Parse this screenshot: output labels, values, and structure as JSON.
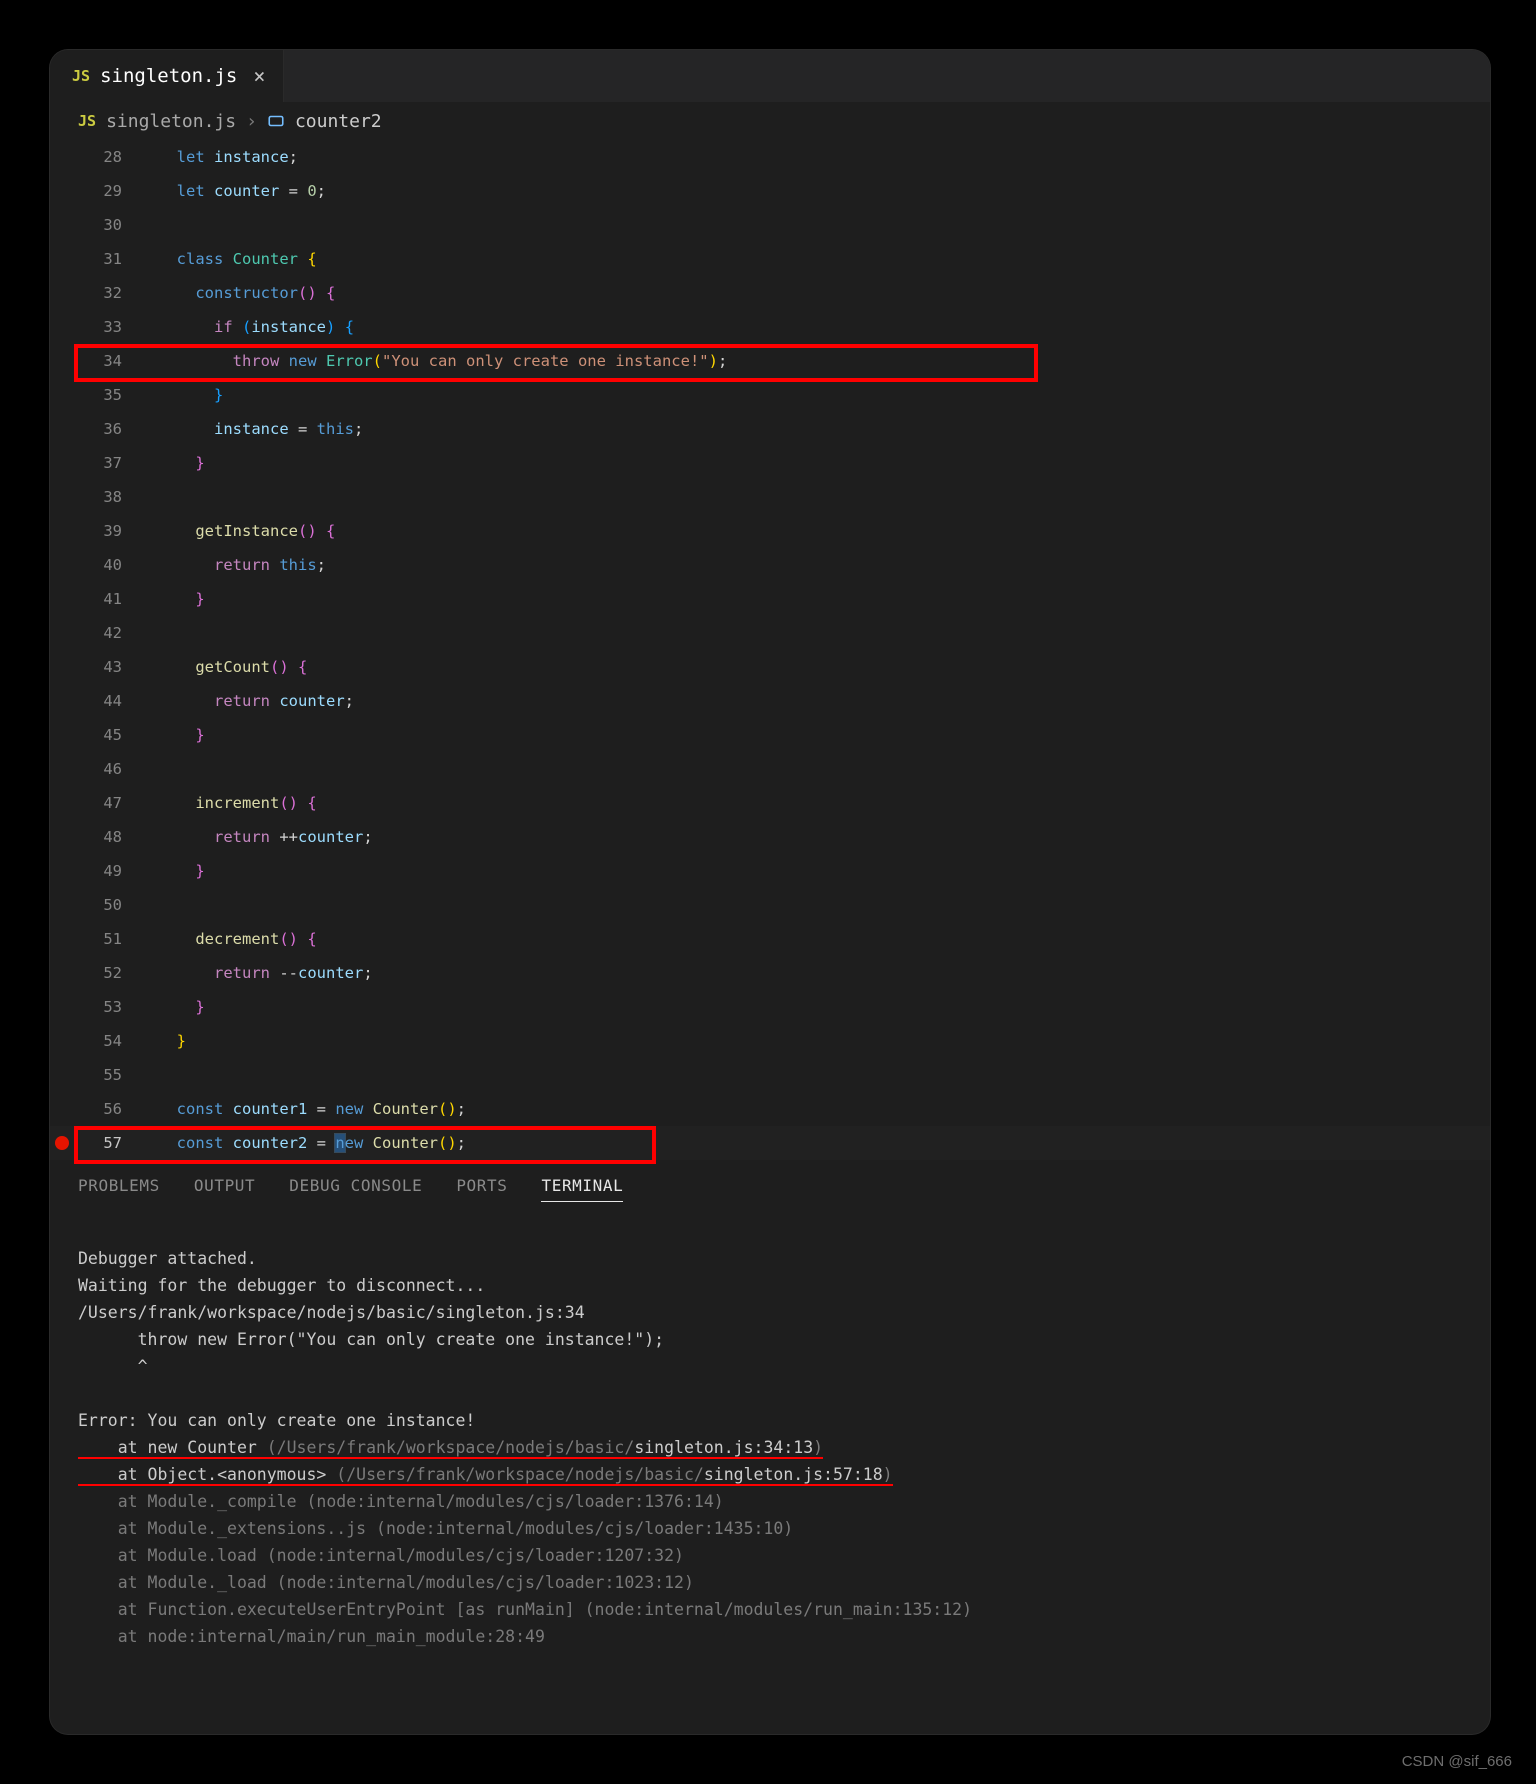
{
  "tab": {
    "icon_label": "JS",
    "filename": "singleton.js",
    "close_glyph": "×"
  },
  "breadcrumb": {
    "icon_label": "JS",
    "file": "singleton.js",
    "sep": "›",
    "symbol_icon": "⊞",
    "symbol": "counter2"
  },
  "code": {
    "lines": [
      {
        "n": "28",
        "ind": 1,
        "tokens": [
          [
            "kw-blue",
            "let "
          ],
          [
            "var",
            "instance"
          ],
          [
            "punc",
            ";"
          ]
        ]
      },
      {
        "n": "29",
        "ind": 1,
        "tokens": [
          [
            "kw-blue",
            "let "
          ],
          [
            "var",
            "counter"
          ],
          [
            "op",
            " = "
          ],
          [
            "num",
            "0"
          ],
          [
            "punc",
            ";"
          ]
        ]
      },
      {
        "n": "30",
        "ind": 0,
        "tokens": []
      },
      {
        "n": "31",
        "ind": 1,
        "tokens": [
          [
            "kw-blue",
            "class "
          ],
          [
            "cls",
            "Counter"
          ],
          [
            "punc",
            " "
          ],
          [
            "paren",
            "{"
          ]
        ]
      },
      {
        "n": "32",
        "ind": 2,
        "tokens": [
          [
            "kw-blue",
            "constructor"
          ],
          [
            "paren2",
            "()"
          ],
          [
            "punc",
            " "
          ],
          [
            "paren2",
            "{"
          ]
        ]
      },
      {
        "n": "33",
        "ind": 3,
        "tokens": [
          [
            "kw-purple",
            "if "
          ],
          [
            "brace-b",
            "("
          ],
          [
            "var",
            "instance"
          ],
          [
            "brace-b",
            ")"
          ],
          [
            "punc",
            " "
          ],
          [
            "brace-b",
            "{"
          ]
        ]
      },
      {
        "n": "34",
        "ind": 4,
        "tokens": [
          [
            "kw-purple",
            "throw "
          ],
          [
            "kw-blue",
            "new "
          ],
          [
            "cls",
            "Error"
          ],
          [
            "paren",
            "("
          ],
          [
            "str",
            "\"You can only create one instance!\""
          ],
          [
            "paren",
            ")"
          ],
          [
            "punc",
            ";"
          ]
        ]
      },
      {
        "n": "35",
        "ind": 3,
        "tokens": [
          [
            "brace-b",
            "}"
          ]
        ]
      },
      {
        "n": "36",
        "ind": 3,
        "tokens": [
          [
            "var",
            "instance"
          ],
          [
            "op",
            " = "
          ],
          [
            "kw-blue",
            "this"
          ],
          [
            "punc",
            ";"
          ]
        ]
      },
      {
        "n": "37",
        "ind": 2,
        "tokens": [
          [
            "paren2",
            "}"
          ]
        ]
      },
      {
        "n": "38",
        "ind": 0,
        "tokens": []
      },
      {
        "n": "39",
        "ind": 2,
        "tokens": [
          [
            "fn",
            "getInstance"
          ],
          [
            "paren2",
            "()"
          ],
          [
            "punc",
            " "
          ],
          [
            "paren2",
            "{"
          ]
        ]
      },
      {
        "n": "40",
        "ind": 3,
        "tokens": [
          [
            "kw-purple",
            "return "
          ],
          [
            "kw-blue",
            "this"
          ],
          [
            "punc",
            ";"
          ]
        ]
      },
      {
        "n": "41",
        "ind": 2,
        "tokens": [
          [
            "paren2",
            "}"
          ]
        ]
      },
      {
        "n": "42",
        "ind": 0,
        "tokens": []
      },
      {
        "n": "43",
        "ind": 2,
        "tokens": [
          [
            "fn",
            "getCount"
          ],
          [
            "paren2",
            "()"
          ],
          [
            "punc",
            " "
          ],
          [
            "paren2",
            "{"
          ]
        ]
      },
      {
        "n": "44",
        "ind": 3,
        "tokens": [
          [
            "kw-purple",
            "return "
          ],
          [
            "var",
            "counter"
          ],
          [
            "punc",
            ";"
          ]
        ]
      },
      {
        "n": "45",
        "ind": 2,
        "tokens": [
          [
            "paren2",
            "}"
          ]
        ]
      },
      {
        "n": "46",
        "ind": 0,
        "tokens": []
      },
      {
        "n": "47",
        "ind": 2,
        "tokens": [
          [
            "fn",
            "increment"
          ],
          [
            "paren2",
            "()"
          ],
          [
            "punc",
            " "
          ],
          [
            "paren2",
            "{"
          ]
        ]
      },
      {
        "n": "48",
        "ind": 3,
        "tokens": [
          [
            "kw-purple",
            "return "
          ],
          [
            "op",
            "++"
          ],
          [
            "var",
            "counter"
          ],
          [
            "punc",
            ";"
          ]
        ]
      },
      {
        "n": "49",
        "ind": 2,
        "tokens": [
          [
            "paren2",
            "}"
          ]
        ]
      },
      {
        "n": "50",
        "ind": 0,
        "tokens": []
      },
      {
        "n": "51",
        "ind": 2,
        "tokens": [
          [
            "fn",
            "decrement"
          ],
          [
            "paren2",
            "()"
          ],
          [
            "punc",
            " "
          ],
          [
            "paren2",
            "{"
          ]
        ]
      },
      {
        "n": "52",
        "ind": 3,
        "tokens": [
          [
            "kw-purple",
            "return "
          ],
          [
            "op",
            "--"
          ],
          [
            "var",
            "counter"
          ],
          [
            "punc",
            ";"
          ]
        ]
      },
      {
        "n": "53",
        "ind": 2,
        "tokens": [
          [
            "paren2",
            "}"
          ]
        ]
      },
      {
        "n": "54",
        "ind": 1,
        "tokens": [
          [
            "paren",
            "}"
          ]
        ]
      },
      {
        "n": "55",
        "ind": 0,
        "tokens": []
      },
      {
        "n": "56",
        "ind": 1,
        "tokens": [
          [
            "kw-blue",
            "const "
          ],
          [
            "var",
            "counter1"
          ],
          [
            "op",
            " = "
          ],
          [
            "kw-blue",
            "new "
          ],
          [
            "fn",
            "Counter"
          ],
          [
            "paren",
            "()"
          ],
          [
            "punc",
            ";"
          ]
        ]
      },
      {
        "n": "57",
        "ind": 1,
        "bp": true,
        "active": true,
        "tokens": [
          [
            "kw-blue",
            "const "
          ],
          [
            "var",
            "counter2"
          ],
          [
            "op",
            " = "
          ],
          [
            "cursor",
            "n"
          ],
          [
            "kw-blue",
            "ew "
          ],
          [
            "fn",
            "Counter"
          ],
          [
            "paren",
            "()"
          ],
          [
            "punc",
            ";"
          ]
        ]
      }
    ]
  },
  "panel": {
    "tabs": {
      "problems": "PROBLEMS",
      "output": "OUTPUT",
      "debug": "DEBUG CONSOLE",
      "ports": "PORTS",
      "terminal": "TERMINAL"
    }
  },
  "terminal": {
    "l1": "Debugger attached.",
    "l2": "Waiting for the debugger to disconnect...",
    "l3": "/Users/frank/workspace/nodejs/basic/singleton.js:34",
    "l4": "      throw new Error(\"You can only create one instance!\");",
    "l5": "      ^",
    "l6": "",
    "l7": "Error: You can only create one instance!",
    "l8a": "    at new Counter ",
    "l8b": "(/Users/frank/workspace/nodejs/basic/",
    "l8c": "singleton.js:34:13",
    "l8d": ")",
    "l9a": "    at Object.<anonymous> ",
    "l9b": "(/Users/frank/workspace/nodejs/basic/",
    "l9c": "singleton.js:57:18",
    "l9d": ")",
    "l10": "    at Module._compile (node:internal/modules/cjs/loader:1376:14)",
    "l11": "    at Module._extensions..js (node:internal/modules/cjs/loader:1435:10)",
    "l12": "    at Module.load (node:internal/modules/cjs/loader:1207:32)",
    "l13": "    at Module._load (node:internal/modules/cjs/loader:1023:12)",
    "l14": "    at Function.executeUserEntryPoint [as runMain] (node:internal/modules/run_main:135:12)",
    "l15": "    at node:internal/main/run_main_module:28:49"
  },
  "watermark": "CSDN @sif_666"
}
